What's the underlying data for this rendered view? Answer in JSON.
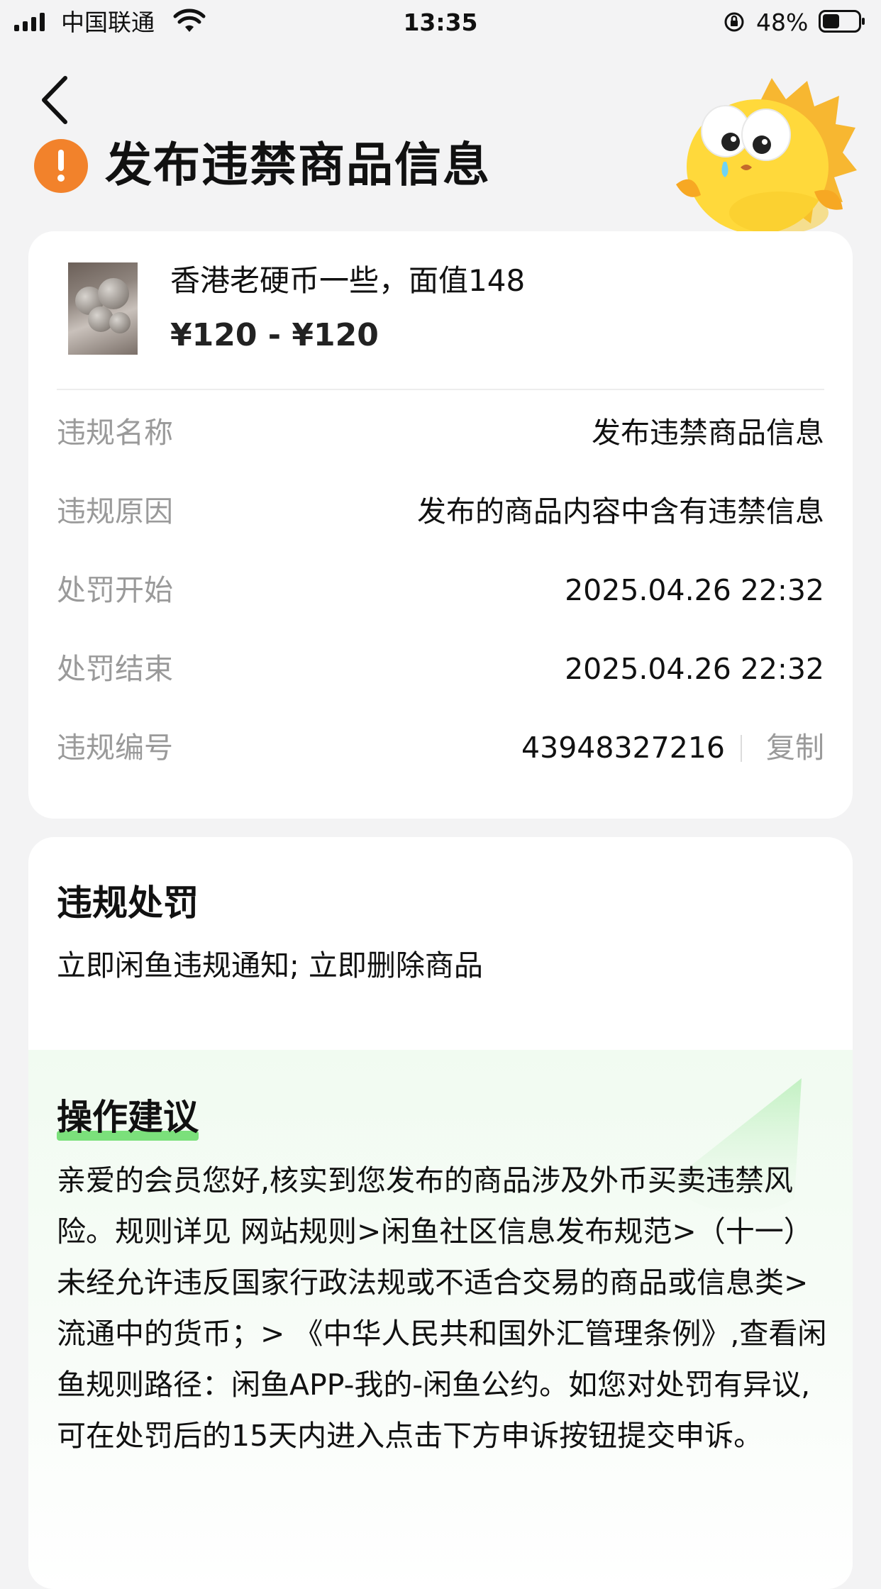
{
  "status_bar": {
    "carrier": "中国联通",
    "time": "13:35",
    "battery_pct": "48%",
    "battery_level": 0.48,
    "icons": [
      "signal-icon",
      "wifi-icon",
      "orientation-lock-icon",
      "battery-icon"
    ]
  },
  "header": {
    "back_icon": "chevron-left-icon",
    "alert_icon": "exclamation-circle-icon",
    "title": "发布违禁商品信息",
    "mascot": "fish-mascot"
  },
  "product": {
    "title": "香港老硬币一些，面值148",
    "price": "¥120 - ¥120"
  },
  "details": [
    {
      "label": "违规名称",
      "value": "发布违禁商品信息"
    },
    {
      "label": "违规原因",
      "value": "发布的商品内容中含有违禁信息"
    },
    {
      "label": "处罚开始",
      "value": "2025.04.26 22:32"
    },
    {
      "label": "处罚结束",
      "value": "2025.04.26 22:32"
    }
  ],
  "violation_id": {
    "label": "违规编号",
    "value": "43948327216",
    "copy_label": "复制"
  },
  "penalty": {
    "title": "违规处罚",
    "text": "立即闲鱼违规通知; 立即删除商品"
  },
  "advice": {
    "title": "操作建议",
    "text": "亲爱的会员您好,核实到您发布的商品涉及外币买卖违禁风险。规则详见 网站规则>闲鱼社区信息发布规范>（十一）未经允许违反国家行政法规或不适合交易的商品或信息类>流通中的货币；> 《中华人民共和国外汇管理条例》,查看闲鱼规则路径：闲鱼APP-我的-闲鱼公约。如您对处罚有异议,可在处罚后的15天内进入点击下方申诉按钮提交申诉。"
  },
  "colors": {
    "alert_orange": "#f2822b",
    "advice_highlight": "#7be07b",
    "muted_label": "#9a9a9a"
  }
}
